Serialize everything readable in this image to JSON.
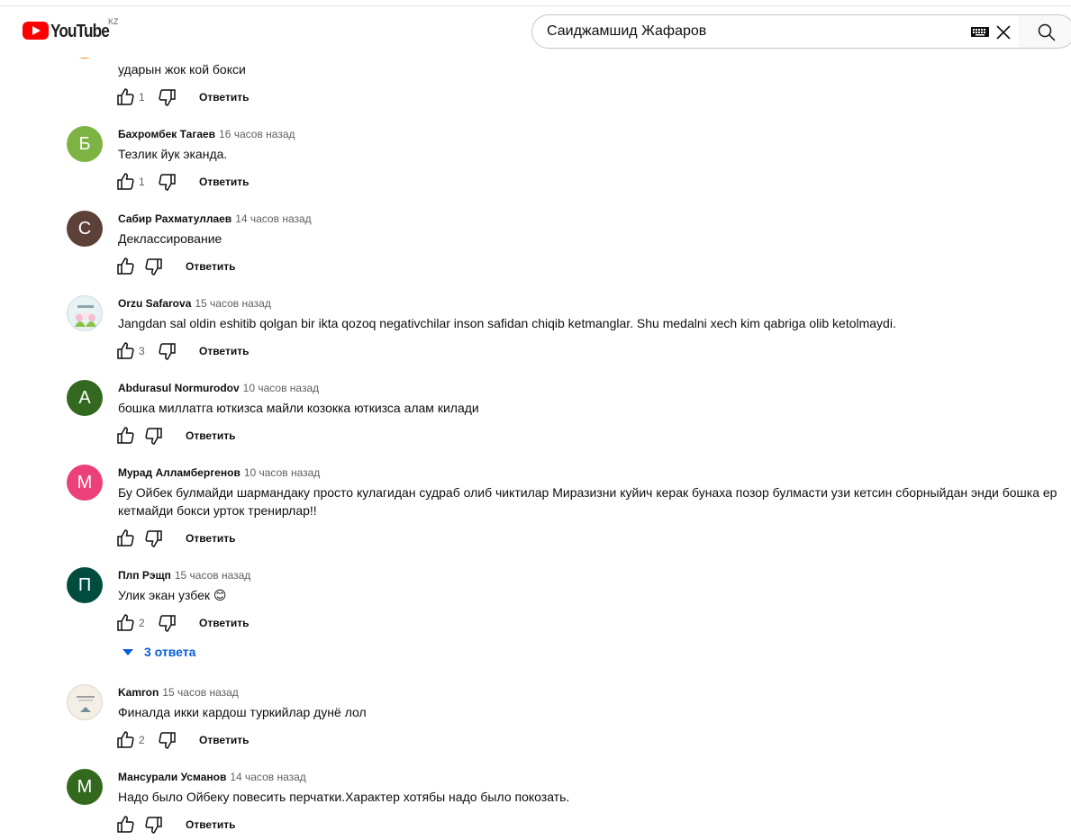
{
  "header": {
    "logo_text": "YouTube",
    "region": "KZ",
    "search_value": "Саиджамшид Жафаров",
    "brand_color": "#ff0000"
  },
  "comments": [
    {
      "text": "ударын жок кой бокси",
      "likes": "1",
      "reply": "Ответить"
    },
    {
      "initial": "Б",
      "avatar_color": "#7cb342",
      "author": "Бахромбек Тагаев",
      "time": "16 часов назад",
      "text": "Тезлик йук эканда.",
      "likes": "1",
      "reply": "Ответить"
    },
    {
      "initial": "С",
      "avatar_color": "#5d4037",
      "author": "Сабир Рахматуллаев",
      "time": "14 часов назад",
      "text": "Деклассирование",
      "likes": "",
      "reply": "Ответить"
    },
    {
      "author": "Orzu Safarova",
      "time": "15 часов назад",
      "text": "Jangdan sal oldin eshitib qolgan bir ikta qozoq negativchilar inson safidan chiqib ketmanglar. Shu medalni xech kim qabriga olib ketolmaydi.",
      "likes": "3",
      "reply": "Ответить"
    },
    {
      "initial": "A",
      "avatar_color": "#33691e",
      "author": "Abdurasul Normurodov",
      "time": "10 часов назад",
      "text": "бошка миллатга юткизса майли козокка юткизса алам килади",
      "likes": "",
      "reply": "Ответить"
    },
    {
      "initial": "М",
      "avatar_color": "#ec407a",
      "author": "Мурад Алламбергенов",
      "time": "10 часов назад",
      "text_line1": "Бу Ойбек булмайди шармандаку просто кулагидан судраб олиб чиктилар Миразизни куйич керак бунаха позор булмасти узи кетсин сборныйдан энди бошка ер",
      "text_line2": "кетмайди бокси урток тренирлар!!",
      "likes": "",
      "reply": "Ответить"
    },
    {
      "initial": "П",
      "avatar_color": "#004d40",
      "author": "Плп Рэщп",
      "time": "15 часов назад",
      "text": "Улик экан узбек 😊",
      "likes": "2",
      "reply": "Ответить",
      "replies_label": "3 ответа"
    },
    {
      "author": "Kamron",
      "time": "15 часов назад",
      "text": "Финалда икки кардош туркийлар дунё лол",
      "likes": "2",
      "reply": "Ответить"
    },
    {
      "initial": "М",
      "avatar_color": "#33691e",
      "author": "Мансурали Усманов",
      "time": "14 часов назад",
      "text": "Надо было Ойбеку повесить перчатки.Характер хотябы надо было покозать.",
      "likes": "",
      "reply": "Ответить"
    }
  ]
}
